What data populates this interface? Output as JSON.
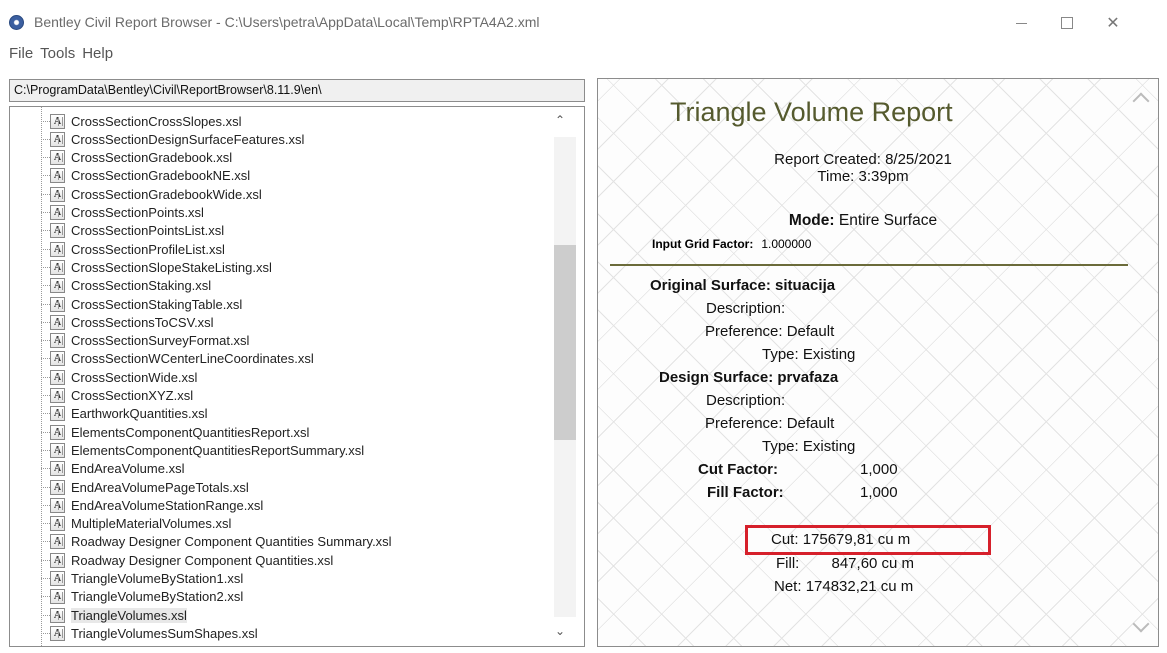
{
  "window": {
    "title": "Bentley Civil Report Browser - C:\\Users\\petra\\AppData\\Local\\Temp\\RPTA4A2.xml",
    "controls": {
      "close": "✕"
    }
  },
  "menu": [
    "File",
    "Tools",
    "Help"
  ],
  "path": "C:\\ProgramData\\Bentley\\Civil\\ReportBrowser\\8.11.9\\en\\",
  "tree": {
    "icon_text": "A",
    "items": [
      "CrossSectionCrossSlopes.xsl",
      "CrossSectionDesignSurfaceFeatures.xsl",
      "CrossSectionGradebook.xsl",
      "CrossSectionGradebookNE.xsl",
      "CrossSectionGradebookWide.xsl",
      "CrossSectionPoints.xsl",
      "CrossSectionPointsList.xsl",
      "CrossSectionProfileList.xsl",
      "CrossSectionSlopeStakeListing.xsl",
      "CrossSectionStaking.xsl",
      "CrossSectionStakingTable.xsl",
      "CrossSectionsToCSV.xsl",
      "CrossSectionSurveyFormat.xsl",
      "CrossSectionWCenterLineCoordinates.xsl",
      "CrossSectionWide.xsl",
      "CrossSectionXYZ.xsl",
      "EarthworkQuantities.xsl",
      "ElementsComponentQuantitiesReport.xsl",
      "ElementsComponentQuantitiesReportSummary.xsl",
      "EndAreaVolume.xsl",
      "EndAreaVolumePageTotals.xsl",
      "EndAreaVolumeStationRange.xsl",
      "MultipleMaterialVolumes.xsl",
      "Roadway Designer Component Quantities Summary.xsl",
      "Roadway Designer Component Quantities.xsl",
      "TriangleVolumeByStation1.xsl",
      "TriangleVolumeByStation2.xsl",
      "TriangleVolumes.xsl",
      "TriangleVolumesSumShapes.xsl"
    ],
    "selected_index": 27
  },
  "report": {
    "title": "Triangle Volume Report",
    "created_label": "Report Created:",
    "created_value": "8/25/2021",
    "time_label": "Time:",
    "time_value": "3:39pm",
    "mode_label": "Mode:",
    "mode_value": "Entire Surface",
    "grid_factor_label": "Input Grid Factor:",
    "grid_factor_value": "1.000000",
    "original_surface_label": "Original Surface:",
    "original_surface_value": "situacija",
    "orig_description_label": "Description:",
    "orig_preference_label": "Preference:",
    "orig_preference_value": "Default",
    "orig_type_label": "Type:",
    "orig_type_value": "Existing",
    "design_surface_label": "Design Surface:",
    "design_surface_value": "prvafaza",
    "des_description_label": "Description:",
    "des_preference_label": "Preference:",
    "des_preference_value": "Default",
    "des_type_label": "Type:",
    "des_type_value": "Existing",
    "cut_factor_label": "Cut Factor:",
    "cut_factor_value": "1,000",
    "fill_factor_label": "Fill Factor:",
    "fill_factor_value": "1,000",
    "cut_label": "Cut:",
    "cut_value": "175679,81 cu m",
    "fill_label": "Fill:",
    "fill_value": "847,60 cu m",
    "net_label": "Net:",
    "net_value": "174832,21 cu m",
    "highlight_color": "#d6202b"
  },
  "colors": {
    "title_olive": "#555a2e",
    "rule_olive": "#6b6b3a"
  }
}
